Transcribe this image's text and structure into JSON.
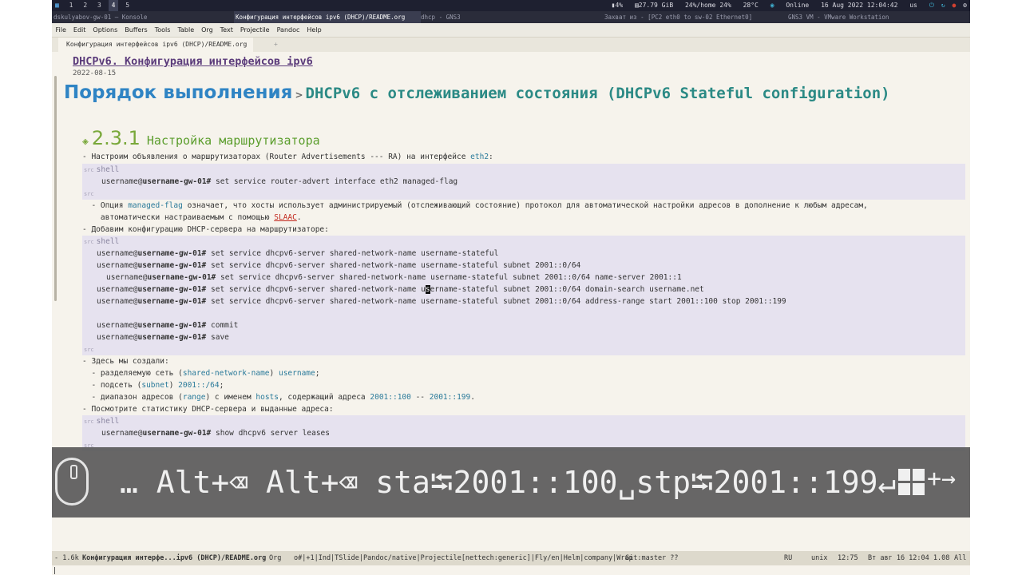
{
  "system": {
    "workspaces": [
      "1",
      "2",
      "3",
      "4",
      "5"
    ],
    "active_workspace": "4",
    "status": {
      "cpu": "4%",
      "disk": "27.79 GiB",
      "home": "24%/home 24%",
      "temp": "28°C",
      "network": "Online",
      "datetime": "16 Aug 2022 12:04:42",
      "layout": "us"
    },
    "tasks": [
      "dskulyabov-gw-01 — Konsole",
      "Конфигурация интерфейсов ipv6 (DHCP)/README.org",
      "dhcp - GNS3",
      "Захват из - [PC2 eth0 to sw-02 Ethernet0]",
      "GNS3 VM - VMware Workstation"
    ]
  },
  "menu": [
    "File",
    "Edit",
    "Options",
    "Buffers",
    "Tools",
    "Table",
    "Org",
    "Text",
    "Projectile",
    "Pandoc",
    "Help"
  ],
  "tab": {
    "label": "Конфигурация интерфейсов ipv6 (DHCP)/README.org",
    "plus": "+"
  },
  "doc": {
    "title": "DHCPv6. Конфигурация интерфейсов ipv6",
    "date": "2022-08-15",
    "h1": "Порядок выполнения",
    "h1_sep": ">",
    "h1_sub": "DHCPv6 с отслеживанием состояния (DHCPv6 Stateful configuration)",
    "h3_bullet": "◈",
    "h3_num": "2.3.1",
    "h3_text": "Настройка маршрутизатора",
    "p1_a": "- Настроим объявления о маршрутизаторах (Router Advertisements --- RA) на интерфейсе ",
    "p1_b": "eth2",
    "p1_c": ":",
    "src_tag": "src",
    "src_lang": "shell",
    "prompt_user": "username@",
    "prompt_host": "username-gw-01#",
    "cmd1": " set service router-advert interface eth2 managed-flag",
    "p2_a": "  - Опция ",
    "p2_b": "managed-flag",
    "p2_c": " означает, что хосты использует администрируемый (отслеживающий состояние) протокол для автоматической настройки адресов в дополнение к любым адресам,",
    "p2_d": "    автоматически настраиваемым с помощью ",
    "p2_e": "SLAAC",
    "p2_f": ".",
    "p3": "- Добавим конфигурацию DHCP-сервера на маршрутизаторе:",
    "cmds": [
      " set service dhcpv6-server shared-network-name username-stateful",
      " set service dhcpv6-server shared-network-name username-stateful subnet 2001::0/64",
      " set service dhcpv6-server shared-network-name username-stateful subnet 2001::0/64 name-server 2001::1",
      " set service dhcpv6-server shared-network-name u",
      " set service dhcpv6-server shared-network-name username-stateful subnet 2001::0/64 address-range start 2001::100 stop 2001::199"
    ],
    "cmd4_cursor": "s",
    "cmd4_rest": "ername-stateful subnet 2001::0/64 domain-search username.net",
    "cmd_commit": " commit",
    "cmd_save": " save",
    "p4": "- Здесь мы создали:",
    "li1_a": "  - разделяемую сеть (",
    "li1_b": "shared-network-name",
    "li1_c": ") ",
    "li1_d": "username",
    "li1_e": ";",
    "li2_a": "  - подсеть (",
    "li2_b": "subnet",
    "li2_c": ") ",
    "li2_d": "2001::/64",
    "li2_e": ";",
    "li3_a": "  - диапазон адресов (",
    "li3_b": "range",
    "li3_c": ") с именем ",
    "li3_d": "hosts",
    "li3_e": ", содержащий адреса ",
    "li3_f": "2001::100",
    "li3_g": " -- ",
    "li3_h": "2001::199",
    "li3_i": ".",
    "p5": "- Посмотрите статистику DHCP-сервера и выданные адреса:",
    "cmd_last": " show dhcpv6 server leases"
  },
  "overlay": {
    "keys": "… Alt+⌫ Alt+⌫ sta⭾2001::100␣stp⭾2001::199↵",
    "win_suffix": "+→"
  },
  "modeline": {
    "size": "- 1.6k",
    "buffer": "Конфигурация интерфе...ipv6 (DHCP)/README.org",
    "mode": "Org",
    "minor": "o#|+1|Ind|TSlide|Pandoc/native|Projectile[nettech:generic]|Fly/en|Helm|company|Wrap",
    "git": "Git:master ??",
    "lang": "RU",
    "eol": "unix",
    "pos": "12:75",
    "time": "Вт авг 16 12:04 1.08",
    "all": "All"
  }
}
